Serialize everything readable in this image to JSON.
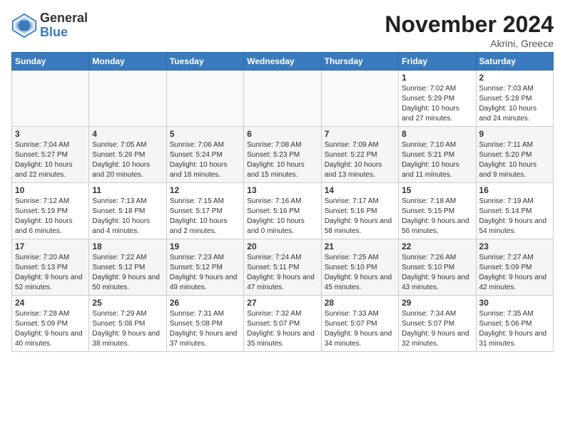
{
  "header": {
    "logo_general": "General",
    "logo_blue": "Blue",
    "title": "November 2024",
    "subtitle": "Akrini, Greece"
  },
  "weekdays": [
    "Sunday",
    "Monday",
    "Tuesday",
    "Wednesday",
    "Thursday",
    "Friday",
    "Saturday"
  ],
  "weeks": [
    [
      {
        "day": "",
        "info": ""
      },
      {
        "day": "",
        "info": ""
      },
      {
        "day": "",
        "info": ""
      },
      {
        "day": "",
        "info": ""
      },
      {
        "day": "",
        "info": ""
      },
      {
        "day": "1",
        "info": "Sunrise: 7:02 AM\nSunset: 5:29 PM\nDaylight: 10 hours and 27 minutes."
      },
      {
        "day": "2",
        "info": "Sunrise: 7:03 AM\nSunset: 5:28 PM\nDaylight: 10 hours and 24 minutes."
      }
    ],
    [
      {
        "day": "3",
        "info": "Sunrise: 7:04 AM\nSunset: 5:27 PM\nDaylight: 10 hours and 22 minutes."
      },
      {
        "day": "4",
        "info": "Sunrise: 7:05 AM\nSunset: 5:26 PM\nDaylight: 10 hours and 20 minutes."
      },
      {
        "day": "5",
        "info": "Sunrise: 7:06 AM\nSunset: 5:24 PM\nDaylight: 10 hours and 18 minutes."
      },
      {
        "day": "6",
        "info": "Sunrise: 7:08 AM\nSunset: 5:23 PM\nDaylight: 10 hours and 15 minutes."
      },
      {
        "day": "7",
        "info": "Sunrise: 7:09 AM\nSunset: 5:22 PM\nDaylight: 10 hours and 13 minutes."
      },
      {
        "day": "8",
        "info": "Sunrise: 7:10 AM\nSunset: 5:21 PM\nDaylight: 10 hours and 11 minutes."
      },
      {
        "day": "9",
        "info": "Sunrise: 7:11 AM\nSunset: 5:20 PM\nDaylight: 10 hours and 9 minutes."
      }
    ],
    [
      {
        "day": "10",
        "info": "Sunrise: 7:12 AM\nSunset: 5:19 PM\nDaylight: 10 hours and 6 minutes."
      },
      {
        "day": "11",
        "info": "Sunrise: 7:13 AM\nSunset: 5:18 PM\nDaylight: 10 hours and 4 minutes."
      },
      {
        "day": "12",
        "info": "Sunrise: 7:15 AM\nSunset: 5:17 PM\nDaylight: 10 hours and 2 minutes."
      },
      {
        "day": "13",
        "info": "Sunrise: 7:16 AM\nSunset: 5:16 PM\nDaylight: 10 hours and 0 minutes."
      },
      {
        "day": "14",
        "info": "Sunrise: 7:17 AM\nSunset: 5:16 PM\nDaylight: 9 hours and 58 minutes."
      },
      {
        "day": "15",
        "info": "Sunrise: 7:18 AM\nSunset: 5:15 PM\nDaylight: 9 hours and 56 minutes."
      },
      {
        "day": "16",
        "info": "Sunrise: 7:19 AM\nSunset: 5:14 PM\nDaylight: 9 hours and 54 minutes."
      }
    ],
    [
      {
        "day": "17",
        "info": "Sunrise: 7:20 AM\nSunset: 5:13 PM\nDaylight: 9 hours and 52 minutes."
      },
      {
        "day": "18",
        "info": "Sunrise: 7:22 AM\nSunset: 5:12 PM\nDaylight: 9 hours and 50 minutes."
      },
      {
        "day": "19",
        "info": "Sunrise: 7:23 AM\nSunset: 5:12 PM\nDaylight: 9 hours and 49 minutes."
      },
      {
        "day": "20",
        "info": "Sunrise: 7:24 AM\nSunset: 5:11 PM\nDaylight: 9 hours and 47 minutes."
      },
      {
        "day": "21",
        "info": "Sunrise: 7:25 AM\nSunset: 5:10 PM\nDaylight: 9 hours and 45 minutes."
      },
      {
        "day": "22",
        "info": "Sunrise: 7:26 AM\nSunset: 5:10 PM\nDaylight: 9 hours and 43 minutes."
      },
      {
        "day": "23",
        "info": "Sunrise: 7:27 AM\nSunset: 5:09 PM\nDaylight: 9 hours and 42 minutes."
      }
    ],
    [
      {
        "day": "24",
        "info": "Sunrise: 7:28 AM\nSunset: 5:09 PM\nDaylight: 9 hours and 40 minutes."
      },
      {
        "day": "25",
        "info": "Sunrise: 7:29 AM\nSunset: 5:08 PM\nDaylight: 9 hours and 38 minutes."
      },
      {
        "day": "26",
        "info": "Sunrise: 7:31 AM\nSunset: 5:08 PM\nDaylight: 9 hours and 37 minutes."
      },
      {
        "day": "27",
        "info": "Sunrise: 7:32 AM\nSunset: 5:07 PM\nDaylight: 9 hours and 35 minutes."
      },
      {
        "day": "28",
        "info": "Sunrise: 7:33 AM\nSunset: 5:07 PM\nDaylight: 9 hours and 34 minutes."
      },
      {
        "day": "29",
        "info": "Sunrise: 7:34 AM\nSunset: 5:07 PM\nDaylight: 9 hours and 32 minutes."
      },
      {
        "day": "30",
        "info": "Sunrise: 7:35 AM\nSunset: 5:06 PM\nDaylight: 9 hours and 31 minutes."
      }
    ]
  ]
}
